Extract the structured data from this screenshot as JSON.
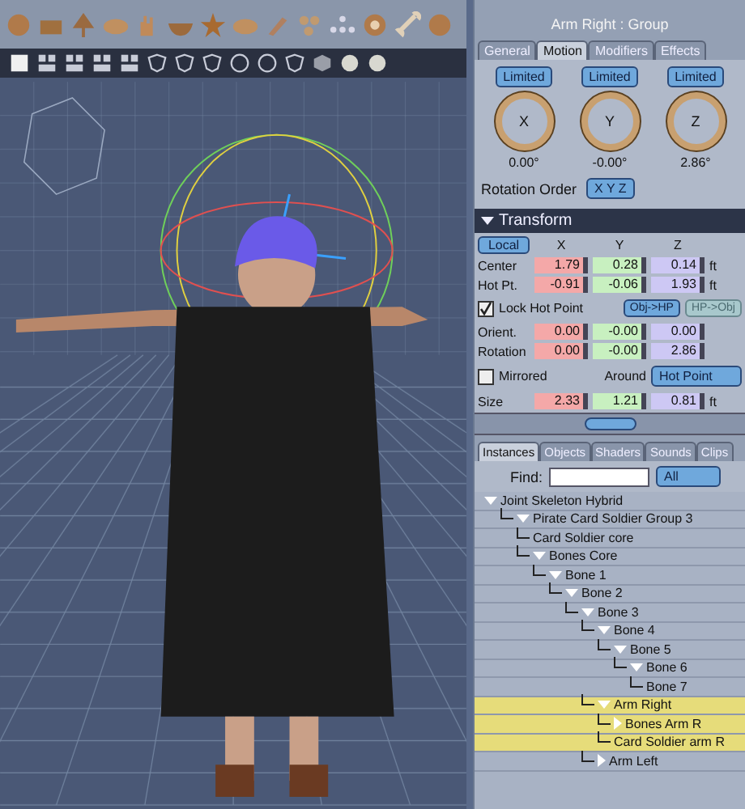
{
  "inspector": {
    "title": "Arm Right : Group",
    "tabs": [
      {
        "label": "General",
        "selected": false
      },
      {
        "label": "Motion",
        "selected": true
      },
      {
        "label": "Modifiers",
        "selected": false
      },
      {
        "label": "Effects",
        "selected": false
      }
    ],
    "dials": [
      {
        "axis": "X",
        "mode": "Limited",
        "value": "0.00°"
      },
      {
        "axis": "Y",
        "mode": "Limited",
        "value": "-0.00°"
      },
      {
        "axis": "Z",
        "mode": "Limited",
        "value": "2.86°"
      }
    ],
    "rotation_order_label": "Rotation Order",
    "rotation_order": "X Y Z"
  },
  "transform": {
    "title": "Transform",
    "expanded": true,
    "space": "Local",
    "axes": [
      "X",
      "Y",
      "Z"
    ],
    "position_rows": [
      {
        "label": "Center",
        "values": [
          "1.79",
          "0.28",
          "0.14"
        ],
        "unit": "ft"
      },
      {
        "label": "Hot Pt.",
        "values": [
          "-0.91",
          "-0.06",
          "1.93"
        ],
        "unit": "ft"
      }
    ],
    "lock_hot_point": {
      "label": "Lock Hot Point",
      "checked": true
    },
    "buttons": [
      {
        "label": "Obj->HP",
        "disabled": false
      },
      {
        "label": "HP->Obj",
        "disabled": true
      }
    ],
    "rotation_rows": [
      {
        "label": "Orient.",
        "values": [
          "0.00",
          "-0.00",
          "0.00"
        ]
      },
      {
        "label": "Rotation",
        "values": [
          "0.00",
          "-0.00",
          "2.86"
        ]
      }
    ],
    "mirrored": {
      "label": "Mirrored",
      "checked": false
    },
    "around_label": "Around",
    "around": "Hot Point",
    "size_row": {
      "label": "Size",
      "values": [
        "2.33",
        "1.21",
        "0.81"
      ],
      "unit": "ft"
    }
  },
  "browser": {
    "tabs": [
      {
        "label": "Instances",
        "selected": true
      },
      {
        "label": "Objects",
        "selected": false
      },
      {
        "label": "Shaders",
        "selected": false
      },
      {
        "label": "Sounds",
        "selected": false
      },
      {
        "label": "Clips",
        "selected": false
      }
    ],
    "find_label": "Find:",
    "filter": "All",
    "tree": [
      {
        "label": "Joint Skeleton Hybrid",
        "expanded": true,
        "selected": false,
        "children": [
          {
            "label": "Pirate Card Soldier Group 3",
            "expanded": true,
            "selected": false,
            "children": [
              {
                "label": "Card Soldier core",
                "selected": false
              },
              {
                "label": "Bones Core",
                "expanded": true,
                "selected": false,
                "children": [
                  {
                    "label": "Bone 1",
                    "expanded": true,
                    "selected": false,
                    "children": [
                      {
                        "label": "Bone 2",
                        "expanded": true,
                        "selected": false,
                        "children": [
                          {
                            "label": "Bone 3",
                            "expanded": true,
                            "selected": false,
                            "children": [
                              {
                                "label": "Bone 4",
                                "expanded": true,
                                "selected": false,
                                "children": [
                                  {
                                    "label": "Bone 5",
                                    "expanded": true,
                                    "selected": false,
                                    "children": [
                                      {
                                        "label": "Bone 6",
                                        "expanded": true,
                                        "selected": false,
                                        "children": [
                                          {
                                            "label": "Bone 7",
                                            "selected": false
                                          }
                                        ]
                                      }
                                    ]
                                  }
                                ]
                              },
                              {
                                "label": "Arm Right",
                                "expanded": true,
                                "selected": true,
                                "children": [
                                  {
                                    "label": "Bones Arm R",
                                    "expanded": false,
                                    "selected": true
                                  },
                                  {
                                    "label": "Card Soldier arm R",
                                    "selected": true
                                  }
                                ]
                              },
                              {
                                "label": "Arm Left",
                                "expanded": false,
                                "selected": false
                              }
                            ]
                          }
                        ]
                      }
                    ]
                  }
                ]
              }
            ]
          }
        ]
      }
    ]
  }
}
